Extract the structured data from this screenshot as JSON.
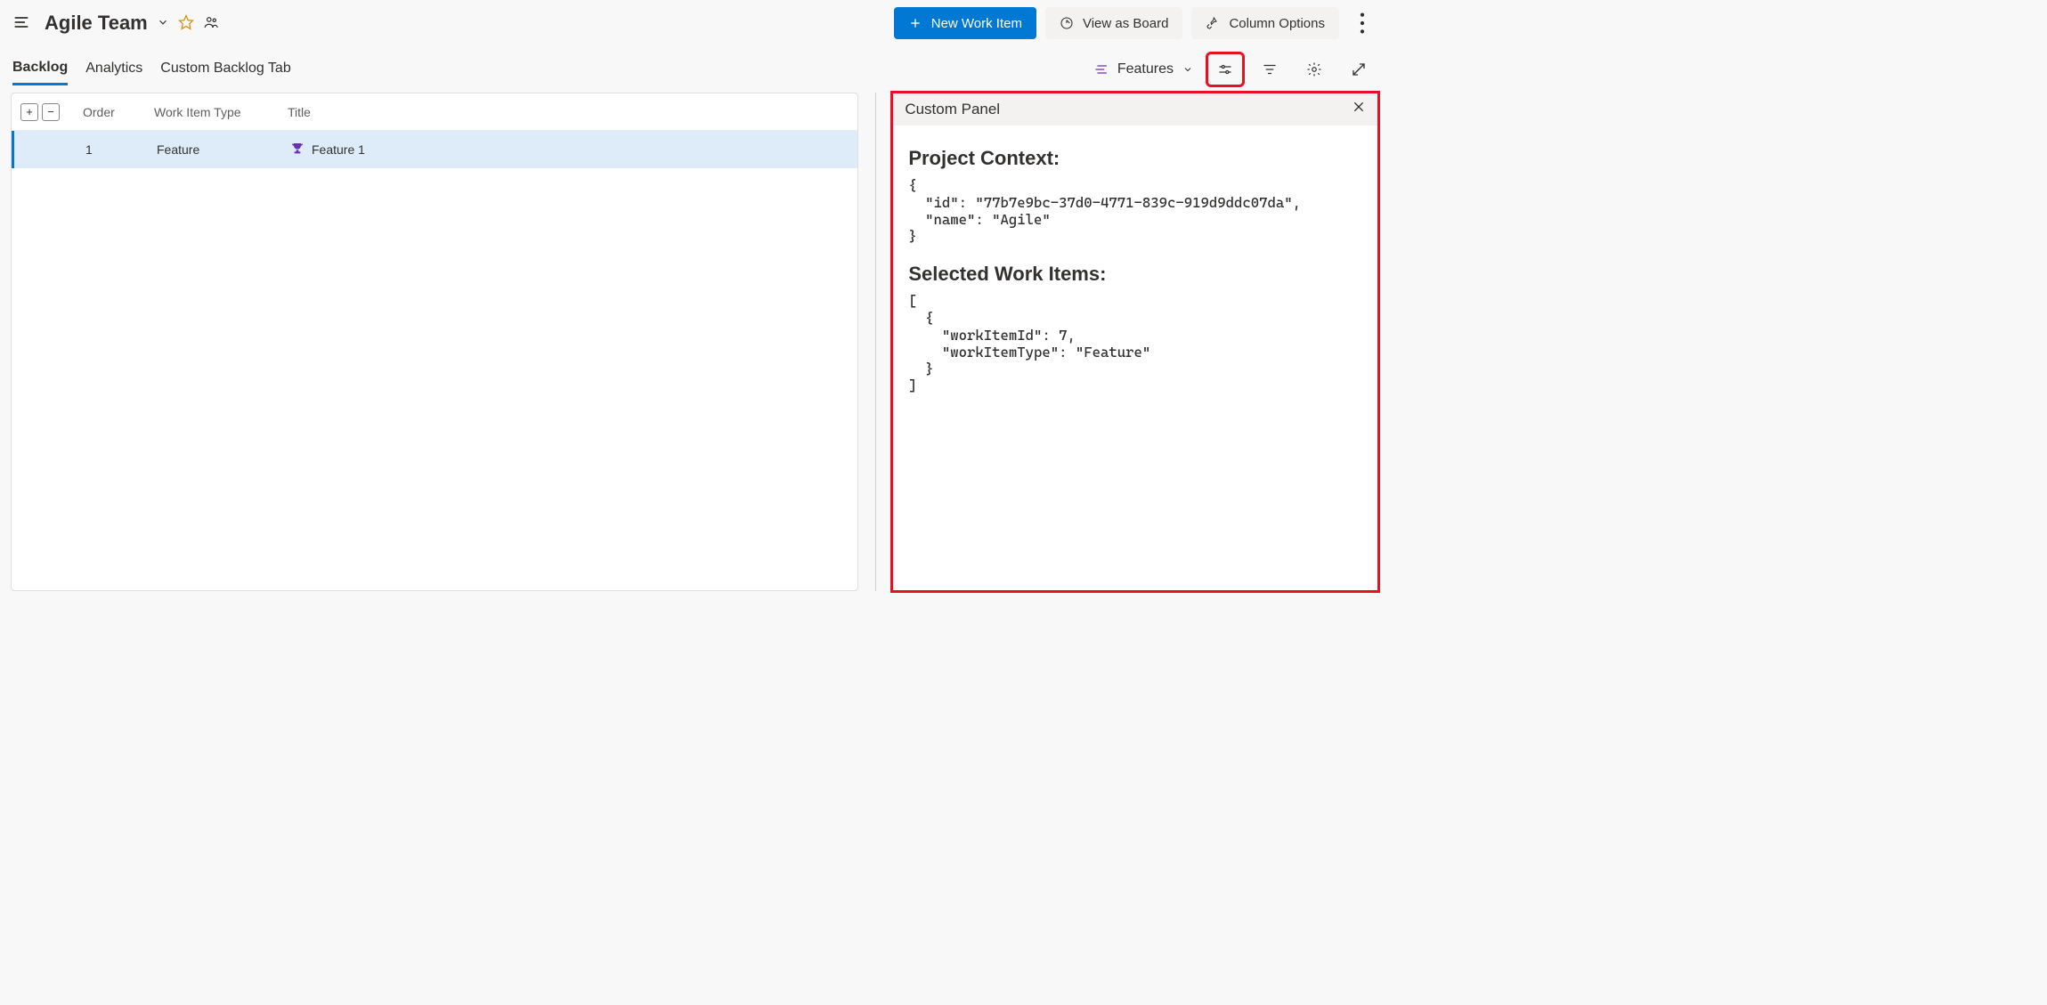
{
  "header": {
    "team_name": "Agile Team",
    "actions": {
      "new_work_item": "New Work Item",
      "view_as_board": "View as Board",
      "column_options": "Column Options"
    }
  },
  "tabs": {
    "backlog": "Backlog",
    "analytics": "Analytics",
    "custom": "Custom Backlog Tab",
    "active": "backlog"
  },
  "toolbar": {
    "level_label": "Features"
  },
  "columns": {
    "order": "Order",
    "type": "Work Item Type",
    "title": "Title"
  },
  "rows": [
    {
      "order": "1",
      "type": "Feature",
      "title": "Feature 1"
    }
  ],
  "panel": {
    "title": "Custom Panel",
    "section_context": "Project Context:",
    "section_selected": "Selected Work Items:",
    "context_json": "{\n  \"id\": \"77b7e9bc-37d0-4771-839c-919d9ddc07da\",\n  \"name\": \"Agile\"\n}",
    "selected_json": "[\n  {\n    \"workItemId\": 7,\n    \"workItemType\": \"Feature\"\n  }\n]"
  }
}
